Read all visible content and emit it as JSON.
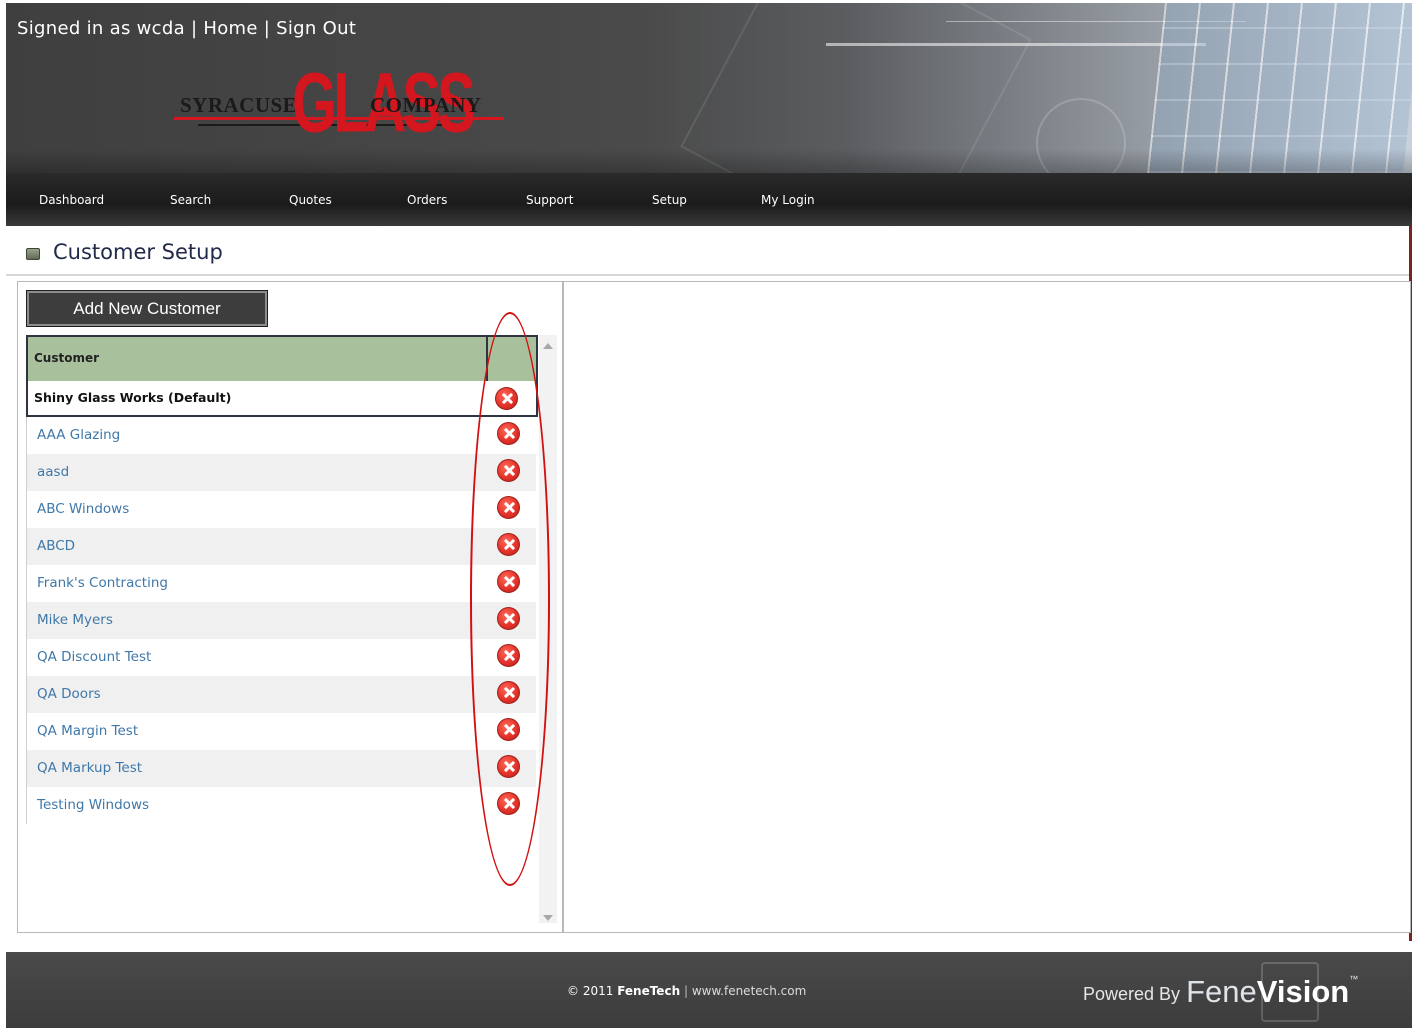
{
  "header": {
    "signed_in_prefix": "Signed in as wcda",
    "sep": "|",
    "home_link": "Home",
    "sign_out_link": "Sign Out",
    "logo_left": "SYRACUSE",
    "logo_center": "GLASS",
    "logo_right": "COMPANY"
  },
  "nav": {
    "items": [
      {
        "label": "Dashboard"
      },
      {
        "label": "Search"
      },
      {
        "label": "Quotes"
      },
      {
        "label": "Orders"
      },
      {
        "label": "Support"
      },
      {
        "label": "Setup"
      },
      {
        "label": "My Login"
      }
    ]
  },
  "page": {
    "title": "Customer Setup",
    "add_button": "Add New Customer"
  },
  "grid": {
    "column_header": "Customer",
    "default_customer": "Shiny Glass Works (Default)",
    "rows": [
      {
        "name": "AAA Glazing"
      },
      {
        "name": "aasd"
      },
      {
        "name": "ABC Windows"
      },
      {
        "name": "ABCD"
      },
      {
        "name": "Frank's Contracting"
      },
      {
        "name": "Mike Myers"
      },
      {
        "name": "QA Discount Test"
      },
      {
        "name": "QA Doors"
      },
      {
        "name": "QA Margin Test"
      },
      {
        "name": "QA Markup Test"
      },
      {
        "name": "Testing Windows"
      }
    ]
  },
  "footer": {
    "copyright": "© 2011",
    "brand": "FeneTech",
    "sep": "|",
    "url": "www.fenetech.com",
    "powered_by": "Powered By",
    "powered_fene": "Fene",
    "powered_vision": "Vision",
    "tm": "™"
  },
  "colors": {
    "grid_header_bg": "#a9c09d",
    "link_color": "#3f78a8",
    "delete_icon": "#e4332b",
    "annotation": "#d21010",
    "nav_bg": "#1b1b1b"
  }
}
